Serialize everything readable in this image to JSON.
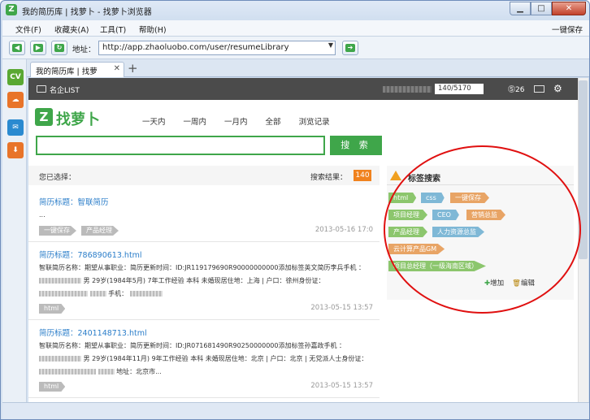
{
  "window": {
    "title": "我的简历库 | 找萝卜 - 找萝卜浏览器",
    "logo": "Z"
  },
  "menubar": {
    "items": [
      "文件(F)",
      "收藏夹(A)",
      "工具(T)",
      "帮助(H)"
    ],
    "one_save": "一键保存"
  },
  "toolbar": {
    "address_label": "地址：",
    "address_value": "http://app.zhaoluobo.com/user/resumeLibrary"
  },
  "sidebar": {
    "icons": [
      {
        "name": "cv-icon",
        "text": "CV",
        "color": "#5aa832"
      },
      {
        "name": "cloud-upload-icon",
        "text": "☁",
        "color": "#e8742a"
      },
      {
        "name": "mail-icon",
        "text": "✉",
        "color": "#2a8ad0"
      },
      {
        "name": "download-icon",
        "text": "⬇",
        "color": "#e8742a"
      }
    ]
  },
  "tab": {
    "label": "我的简历库 | 找萝"
  },
  "page": {
    "topbar": {
      "list_label": "名企LIST",
      "quota": "140/5170",
      "coins": "26"
    },
    "logo_text": "找萝卜",
    "filters": [
      "一天内",
      "一周内",
      "一月内",
      "全部",
      "浏览记录"
    ],
    "search_button": "搜 索",
    "selected_label": "您已选择：",
    "result_label": "搜索结果：",
    "result_count": "140",
    "resumes": [
      {
        "title": "简历标题：智联简历",
        "lines": [
          "..."
        ],
        "tags": [
          "一键保存",
          "产品经理"
        ],
        "date": "2013-05-16 17:0"
      },
      {
        "title": "简历标题：786890613.html",
        "lines": [
          "智联简历名称：期望从事职业：简历更新时间：ID:JR119179690R90000000000添加标签英文简历李兵手机 ：",
          "男 29岁(1984年5月) 7年工作经验 本科 未婚现居住地：上海 | 户口：徐州身份证：",
          "手机："
        ],
        "tags": [
          "html"
        ],
        "date": "2013-05-15 13:57"
      },
      {
        "title": "简历标题：2401148713.html",
        "lines": [
          "智联简历名称：期望从事职业：简历更新时间：ID:JR071681490R90250000000添加标签孙嘉政手机 ：",
          "男 29岁(1984年11月) 9年工作经验 本科 未婚现居住地：北京 | 户口：北京 | 无党派人士身份证：",
          "地址：北京市..."
        ],
        "tags": [
          "html"
        ],
        "date": "2013-05-15 13:57"
      }
    ],
    "tag_panel": {
      "title": "标签搜索",
      "tags": [
        {
          "label": "html",
          "color": "#8cc66d"
        },
        {
          "label": "css",
          "color": "#7fb8d6"
        },
        {
          "label": "一键保存",
          "color": "#e8a465"
        },
        {
          "label": "项目经理",
          "color": "#8cc66d"
        },
        {
          "label": "CEO",
          "color": "#7fb8d6"
        },
        {
          "label": "营销总监",
          "color": "#e8a465"
        },
        {
          "label": "产品经理",
          "color": "#8cc66d"
        },
        {
          "label": "人力资源总监",
          "color": "#7fb8d6"
        },
        {
          "label": "云计算产品GM",
          "color": "#e8a465"
        },
        {
          "label": "项目总经理（一级海南区域）",
          "color": "#8cc66d"
        }
      ],
      "add_label": "增加",
      "edit_label": "编辑"
    }
  }
}
